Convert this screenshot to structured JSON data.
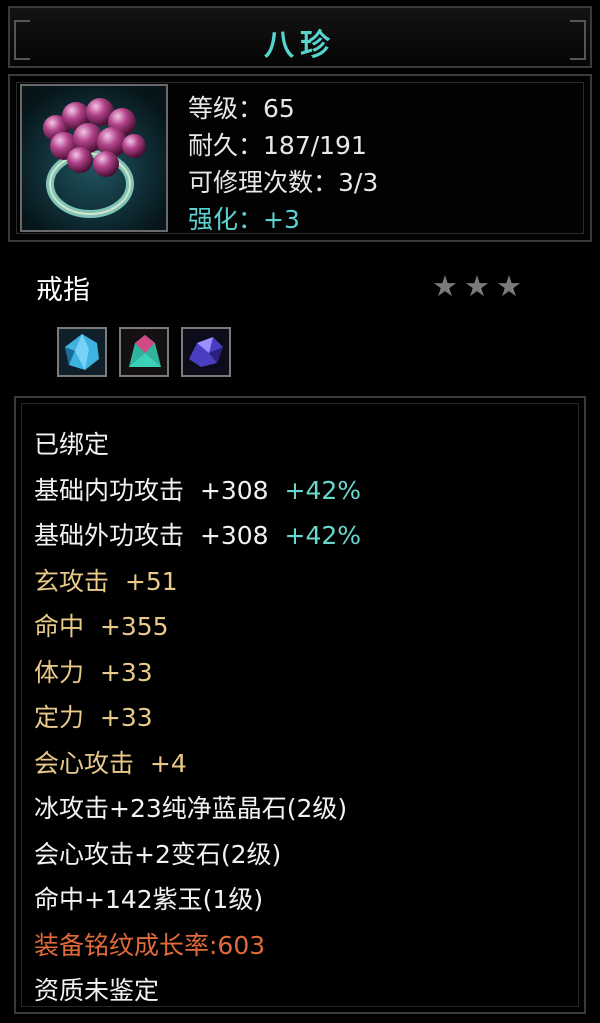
{
  "item": {
    "name": "八珍",
    "type": "戒指",
    "stars": 3,
    "header": {
      "level_label": "等级：",
      "level": "65",
      "durability_label": "耐久：",
      "durability": "187/191",
      "repairs_label": "可修理次数：",
      "repairs": "3/3",
      "enhance_label": "强化：",
      "enhance": "+3"
    },
    "gems": [
      "blue-crystal-gem-icon",
      "variegated-stone-gem-icon",
      "purple-jade-gem-icon"
    ],
    "bound": "已绑定",
    "base_attrs": [
      {
        "label": "基础内功攻击",
        "value": "+308",
        "pct": "+42%"
      },
      {
        "label": "基础外功攻击",
        "value": "+308",
        "pct": "+42%"
      }
    ],
    "bonus_attrs": [
      {
        "label": "玄攻击",
        "value": "+51"
      },
      {
        "label": "命中",
        "value": "+355"
      },
      {
        "label": "体力",
        "value": "+33"
      },
      {
        "label": "定力",
        "value": "+33"
      },
      {
        "label": "会心攻击",
        "value": "+4"
      }
    ],
    "gem_attrs": [
      "冰攻击+23纯净蓝晶石(2级)",
      "会心攻击+2变石(2级)",
      "命中+142紫玉(1级)"
    ],
    "growth": "装备铭纹成长率:603",
    "quality": "资质未鉴定"
  },
  "colors": {
    "title": "#56d4ce",
    "enhance": "#5ad2d0",
    "bonus": "#e8c98a",
    "percent": "#68d8cf",
    "growth": "#e06a3a"
  }
}
